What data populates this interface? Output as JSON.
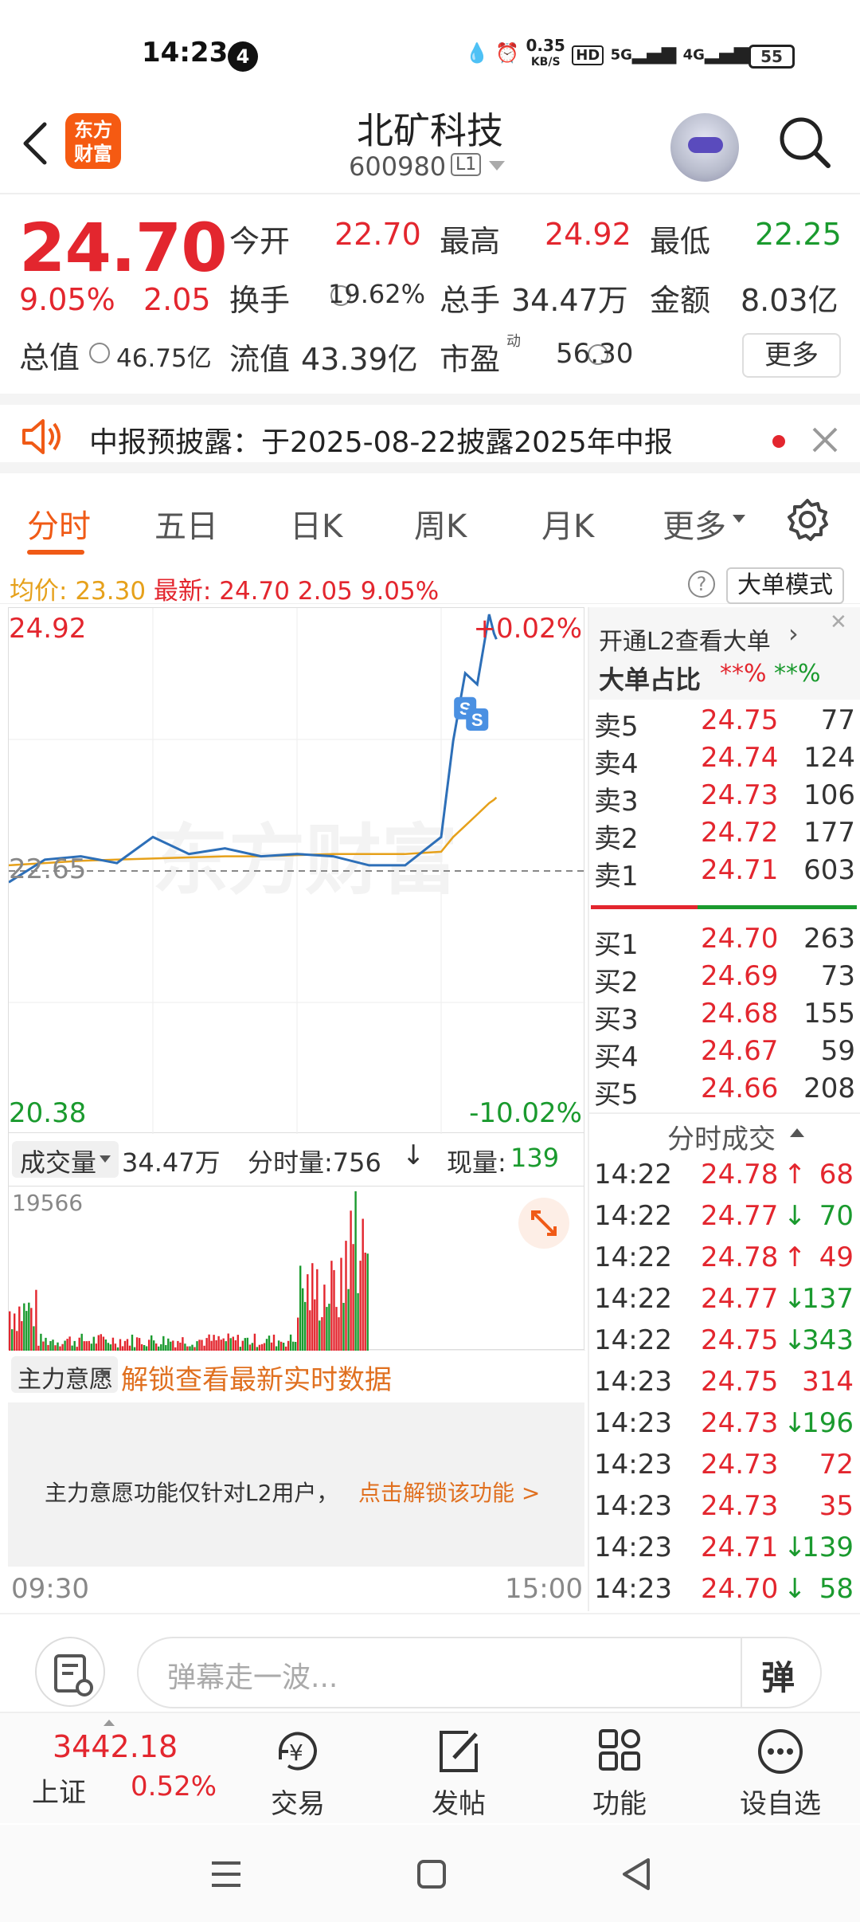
{
  "status_bar": {
    "time": "14:23",
    "notif_count": "4",
    "speed": "0.35",
    "speed_unit": "KB/S",
    "hd": "HD",
    "net1": "5G",
    "net2": "4G",
    "battery": "55"
  },
  "header": {
    "logo_text": "东方\n财富",
    "stock_name": "北矿科技",
    "stock_code": "600980",
    "level": "L1"
  },
  "quote": {
    "price": "24.70",
    "change_pct": "9.05%",
    "change": "2.05",
    "open_label": "今开",
    "open": "22.70",
    "high_label": "最高",
    "high": "24.92",
    "low_label": "最低",
    "low": "22.25",
    "turnover_label": "换手",
    "turnover": "19.62%",
    "volume_label": "总手",
    "volume": "34.47万",
    "amount_label": "金额",
    "amount": "8.03亿",
    "mktcap_label": "总值",
    "mktcap": "46.75亿",
    "float_label": "流值",
    "float_cap": "43.39亿",
    "pe_label": "市盈",
    "pe_sup": "动",
    "pe": "56.30",
    "more": "更多"
  },
  "notice": {
    "text": "中报预披露：于2025-08-22披露2025年中报"
  },
  "tabs": [
    "分时",
    "五日",
    "日K",
    "周K",
    "月K",
    "更多"
  ],
  "avg_line": {
    "avg_label": "均价:",
    "avg": "23.30",
    "latest_label": "最新:",
    "latest": "24.70",
    "change": "2.05",
    "change_pct": "9.05%",
    "help": "?",
    "big_order_mode": "大单模式"
  },
  "chart_labels": {
    "top": "24.92",
    "top_pct": "+0.02%",
    "mid": "22.65",
    "bottom": "20.38",
    "bottom_pct": "-10.02%",
    "watermark": "东方财富",
    "marker": "S"
  },
  "volume_header": {
    "label": "成交量",
    "total": "34.47万",
    "tick_label": "分时量:756",
    "now_label": "现量:",
    "now": "139",
    "max": "19566"
  },
  "zhuli": {
    "label": "主力意愿",
    "unlock": "解锁查看最新实时数据",
    "info": "主力意愿功能仅针对L2用户，",
    "link": "点击解锁该功能 >"
  },
  "time_axis": {
    "start": "09:30",
    "end": "15:00"
  },
  "orderbook": {
    "l2_link": "开通L2查看大单",
    "big_ratio_label": "大单占比",
    "big_ratio_buy": "**%",
    "big_ratio_sell": "**%",
    "asks": [
      {
        "label": "卖5",
        "price": "24.75",
        "vol": "77"
      },
      {
        "label": "卖4",
        "price": "24.74",
        "vol": "124"
      },
      {
        "label": "卖3",
        "price": "24.73",
        "vol": "106"
      },
      {
        "label": "卖2",
        "price": "24.72",
        "vol": "177"
      },
      {
        "label": "卖1",
        "price": "24.71",
        "vol": "603"
      }
    ],
    "bids": [
      {
        "label": "买1",
        "price": "24.70",
        "vol": "263"
      },
      {
        "label": "买2",
        "price": "24.69",
        "vol": "73"
      },
      {
        "label": "买3",
        "price": "24.68",
        "vol": "155"
      },
      {
        "label": "买4",
        "price": "24.67",
        "vol": "59"
      },
      {
        "label": "买5",
        "price": "24.66",
        "vol": "208"
      }
    ],
    "trades_header": "分时成交",
    "trades": [
      {
        "time": "14:22",
        "price": "24.78",
        "arrow": "↑",
        "vol": "68",
        "dir": "up"
      },
      {
        "time": "14:22",
        "price": "24.77",
        "arrow": "↓",
        "vol": "70",
        "dir": "down"
      },
      {
        "time": "14:22",
        "price": "24.78",
        "arrow": "↑",
        "vol": "49",
        "dir": "up"
      },
      {
        "time": "14:22",
        "price": "24.77",
        "arrow": "↓",
        "vol": "137",
        "dir": "down"
      },
      {
        "time": "14:22",
        "price": "24.75",
        "arrow": "↓",
        "vol": "343",
        "dir": "down"
      },
      {
        "time": "14:23",
        "price": "24.75",
        "arrow": "",
        "vol": "314",
        "dir": "up"
      },
      {
        "time": "14:23",
        "price": "24.73",
        "arrow": "↓",
        "vol": "196",
        "dir": "down"
      },
      {
        "time": "14:23",
        "price": "24.73",
        "arrow": "",
        "vol": "72",
        "dir": "up"
      },
      {
        "time": "14:23",
        "price": "24.73",
        "arrow": "",
        "vol": "35",
        "dir": "up"
      },
      {
        "time": "14:23",
        "price": "24.71",
        "arrow": "↓",
        "vol": "139",
        "dir": "down"
      },
      {
        "time": "14:23",
        "price": "24.70",
        "arrow": "↓",
        "vol": "58",
        "dir": "down"
      }
    ]
  },
  "comment": {
    "placeholder": "弹幕走一波...",
    "danmu": "弹"
  },
  "bottom_nav": {
    "index_value": "3442.18",
    "index_name": "上证",
    "index_pct": "0.52%",
    "trade": "交易",
    "post": "发帖",
    "function": "功能",
    "watchlist": "设自选"
  },
  "colors": {
    "up": "#e3262e",
    "down": "#1a9a2e",
    "accent": "#f05a16",
    "avg_line": "#e6a11b",
    "price_line": "#2d6fb8"
  },
  "chart_data": {
    "type": "line",
    "title": "",
    "x": [
      "09:30",
      "09:45",
      "10:00",
      "10:15",
      "10:30",
      "10:45",
      "11:00",
      "11:15",
      "11:30",
      "13:15",
      "13:30",
      "13:45",
      "14:00",
      "14:05",
      "14:10",
      "14:15",
      "14:20",
      "14:22",
      "14:23"
    ],
    "series": [
      {
        "values": [
          22.55,
          22.75,
          22.78,
          22.72,
          22.95,
          22.8,
          22.85,
          22.78,
          22.8,
          22.78,
          22.7,
          22.7,
          22.95,
          23.8,
          24.4,
          24.3,
          24.92,
          24.75,
          24.7
        ]
      },
      {
        "values": [
          22.7,
          22.72,
          22.74,
          22.75,
          22.76,
          22.77,
          22.78,
          22.78,
          22.79,
          22.8,
          22.8,
          22.8,
          22.82,
          22.95,
          23.05,
          23.15,
          23.25,
          23.28,
          23.3
        ]
      }
    ],
    "ylim": [
      20.38,
      24.92
    ],
    "ref": 22.65,
    "volume_max": 19566
  }
}
